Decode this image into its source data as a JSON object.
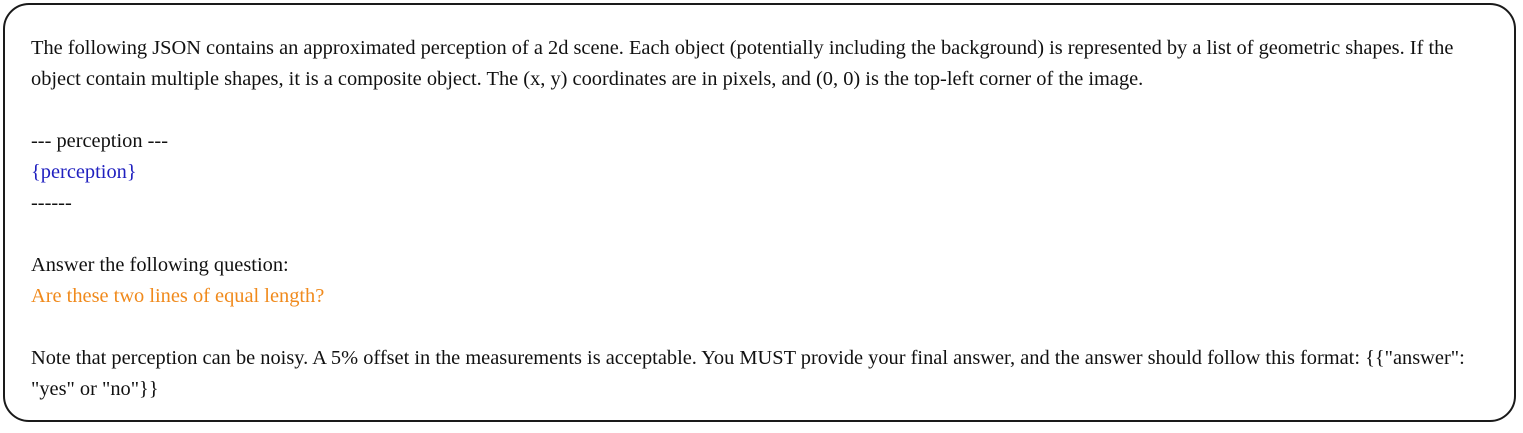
{
  "intro": "The following JSON contains an approximated perception of a 2d scene. Each object (potentially including the background) is represented by a list of geometric shapes. If the object contain multiple shapes, it is a composite object. The (x, y) coordinates are in pixels, and (0, 0) is the top-left corner of the image.",
  "perception_header": "--- perception ---",
  "perception_placeholder": "{perception}",
  "perception_footer": "------",
  "question_prompt": "Answer the following question:",
  "question": "Are these two lines of equal length?",
  "note": "Note that perception can be noisy. A 5% offset in the measurements is acceptable. You MUST provide your final answer, and the answer should follow this format: {{\"answer\": \"yes\" or \"no\"}}",
  "colors": {
    "perception_placeholder": "#1f1fbf",
    "question": "#f08a1c",
    "text": "#111111",
    "border": "#1a1a1a"
  }
}
